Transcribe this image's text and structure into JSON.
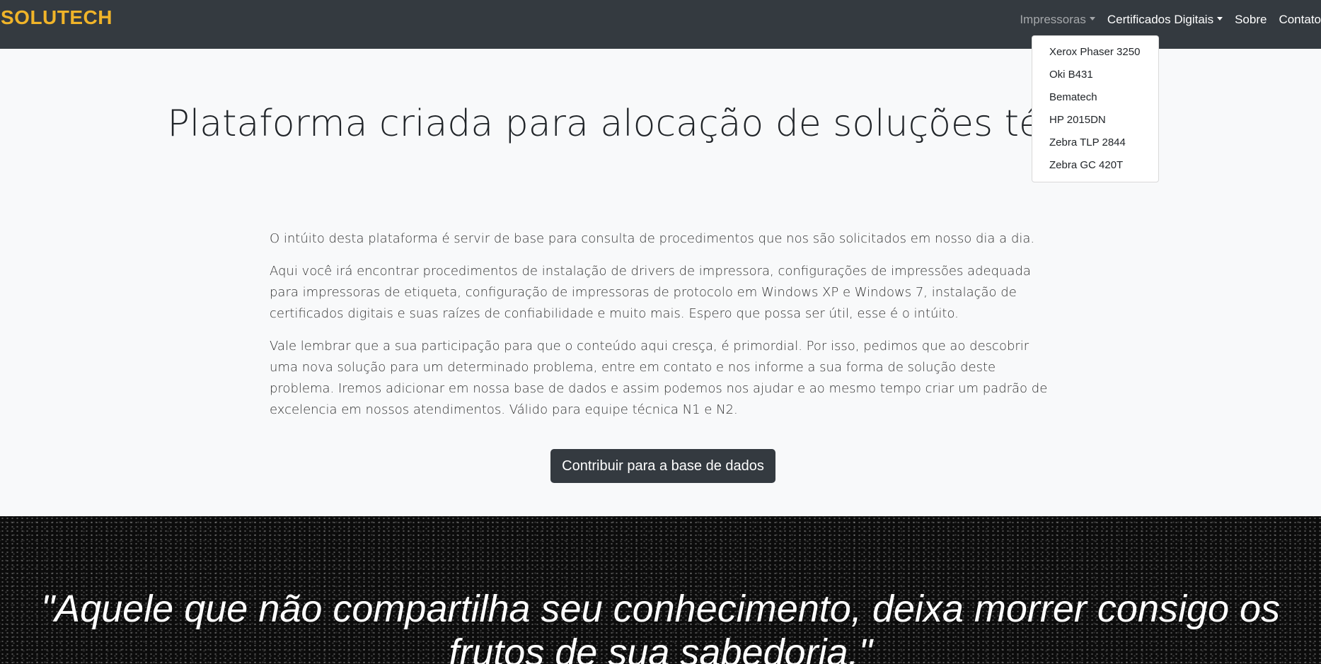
{
  "brand": "SOLUTECH",
  "nav": {
    "printers": "Impressoras",
    "certificates": "Certificados Digitais",
    "about": "Sobre",
    "contact": "Contato"
  },
  "printers_menu": [
    "Xerox Phaser 3250",
    "Oki B431",
    "Bematech",
    "HP 2015DN",
    "Zebra TLP 2844",
    "Zebra GC 420T"
  ],
  "hero": {
    "title": "Plataforma criada para alocação de soluções técnicas"
  },
  "paragraphs": [
    "O intúito desta plataforma é servir de base para consulta de procedimentos que nos são solicitados em nosso dia a dia.",
    "Aqui você irá encontrar procedimentos de instalação de drivers de impressora, configurações de impressões adequada para impressoras de etiqueta, configuração de impressoras de protocolo em Windows XP e Windows 7, instalação de certificados digitais e suas raízes de confiabilidade e muito mais. Espero que possa ser útil, esse é o intúito.",
    "Vale lembrar que a sua participação para que o conteúdo aqui cresça, é primordial. Por isso, pedimos que ao descobrir uma nova solução para um determinado problema, entre em contato e nos informe a sua forma de solução deste problema. Iremos adicionar em nossa base de dados e assim podemos nos ajudar e ao mesmo tempo criar um padrão de excelencia em nossos atendimentos. Válido para equipe técnica N1 e N2."
  ],
  "cta_label": "Contribuir para a base de dados",
  "quote": "\"Aquele que não compartilha seu conhecimento, deixa morrer consigo os frutos de sua sabedoria.\"",
  "colors": {
    "navbar": "#343a40",
    "brand": "#f0b429",
    "background": "#f8f9fa",
    "quote_section": "#0c0c0c"
  }
}
